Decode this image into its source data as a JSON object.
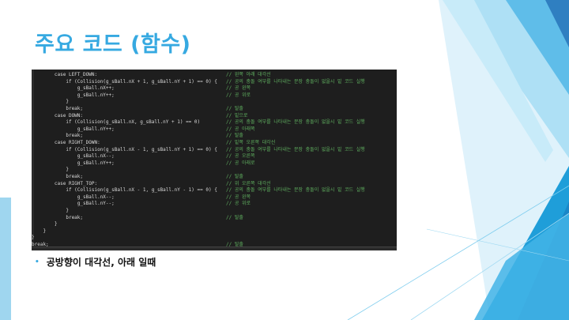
{
  "slide": {
    "title": "주요 코드 (함수)",
    "bullet": "공방향이 대각선, 아래 일때",
    "bullet_marker": "•",
    "accent_color": "#36a9e1"
  },
  "code": {
    "lines": [
      {
        "text": "        case LEFT_DOWN:",
        "comment": "// 왼쪽 아래 대각선"
      },
      {
        "text": "            if (Collision(g_sBall.nX + 1, g_sBall.nY + 1) == 0) {",
        "comment": "// 공의 충돌 여부를 나타내는 문장 충돌이 없을시 밑 코드 실행"
      },
      {
        "text": "                g_sBall.nX++;",
        "comment": "// 공 왼쪽"
      },
      {
        "text": "                g_sBall.nY++;",
        "comment": "// 공 위로"
      },
      {
        "text": "            }",
        "comment": ""
      },
      {
        "text": "            break;",
        "comment": "// 탈출"
      },
      {
        "text": "        case DOWN:",
        "comment": "// 밑으로"
      },
      {
        "text": "            if (Collision(g_sBall.nX, g_sBall.nY + 1) == 0)",
        "comment": "// 공의 충돌 여부를 나타내는 문장 충돌이 없을시 밑 코드 실행"
      },
      {
        "text": "                g_sBall.nY++;",
        "comment": "// 공 아래쪽"
      },
      {
        "text": "            break;",
        "comment": "// 탈출"
      },
      {
        "text": "        case RIGHT_DOWN:",
        "comment": "// 밑쪽 오른쪽 대각선"
      },
      {
        "text": "            if (Collision(g_sBall.nX - 1, g_sBall.nY + 1) == 0) {",
        "comment": "// 공의 충돌 여부를 나타내는 문장 충돌이 없을시 밑 코드 실행"
      },
      {
        "text": "                g_sBall.nX--;",
        "comment": "// 공 오른쪽"
      },
      {
        "text": "                g_sBall.nY++;",
        "comment": "// 공 아래로"
      },
      {
        "text": "            }",
        "comment": ""
      },
      {
        "text": "            break;",
        "comment": "// 탈출"
      },
      {
        "text": "        case RIGHT_TOP:",
        "comment": "// 위 오른쪽 대각선"
      },
      {
        "text": "            if (Collision(g_sBall.nX - 1, g_sBall.nY - 1) == 0) {",
        "comment": "// 공의 충돌 여부를 나타내는 문장 충돌이 없을시 밑 코드 실행"
      },
      {
        "text": "                g_sBall.nX--;",
        "comment": "// 공 왼쪽"
      },
      {
        "text": "                g_sBall.nY--;",
        "comment": "// 공 위로"
      },
      {
        "text": "            }",
        "comment": ""
      },
      {
        "text": "            break;",
        "comment": "// 탈출"
      },
      {
        "text": "        }",
        "comment": ""
      },
      {
        "text": "    }",
        "comment": ""
      },
      {
        "text": "}",
        "comment": ""
      },
      {
        "text": "break;",
        "comment": "// 탈출"
      }
    ]
  }
}
